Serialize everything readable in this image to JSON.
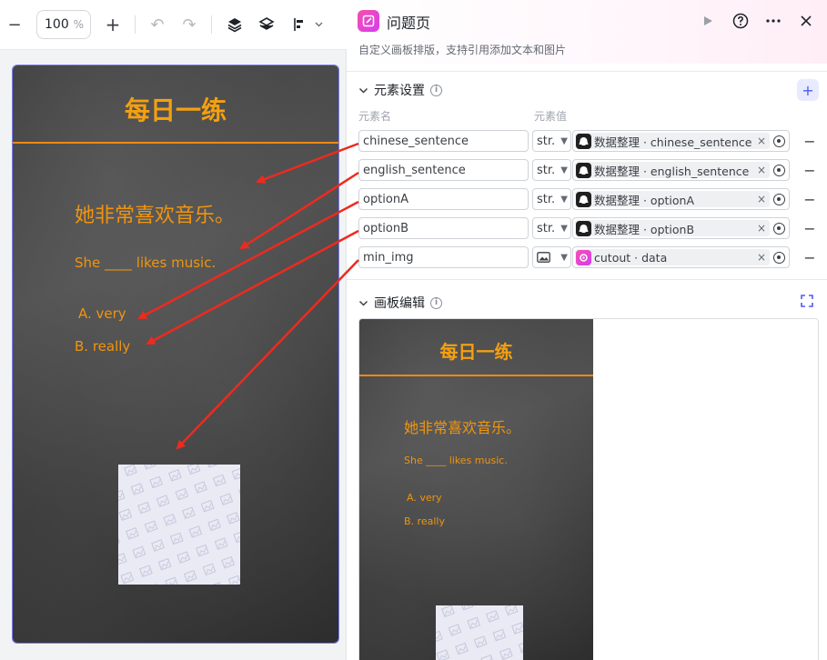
{
  "toolbar": {
    "zoom_minus": "−",
    "zoom_value": "100",
    "zoom_unit": "%",
    "zoom_plus": "+",
    "undo": "↶",
    "redo": "↷"
  },
  "poster": {
    "title": "每日一练",
    "chinese_sentence": "她非常喜欢音乐。",
    "english_sentence": "She ____ likes music.",
    "optionA": "A. very",
    "optionB": "B. really"
  },
  "panel": {
    "title": "问题页",
    "description": "自定义画板排版，支持引用添加文本和图片",
    "elements_section": "元素设置",
    "col_name": "元素名",
    "col_value": "元素值",
    "canvas_section": "画板编辑",
    "add_label": "+",
    "remove_label": "−",
    "clear_label": "×"
  },
  "elements": [
    {
      "name": "chinese_sentence",
      "type": "str.",
      "source": "数据整理 · chinese_sentence"
    },
    {
      "name": "english_sentence",
      "type": "str.",
      "source": "数据整理 · english_sentence"
    },
    {
      "name": "optionA",
      "type": "str.",
      "source": "数据整理 · optionA"
    },
    {
      "name": "optionB",
      "type": "str.",
      "source": "数据整理 · optionB"
    },
    {
      "name": "min_img",
      "type": "image",
      "source": "cutout · data"
    }
  ],
  "colors": {
    "accent": "#4d5bf5",
    "poster_text": "#f0950e",
    "arrow": "#ee2a1f",
    "brand_pink": "#f54fae"
  }
}
